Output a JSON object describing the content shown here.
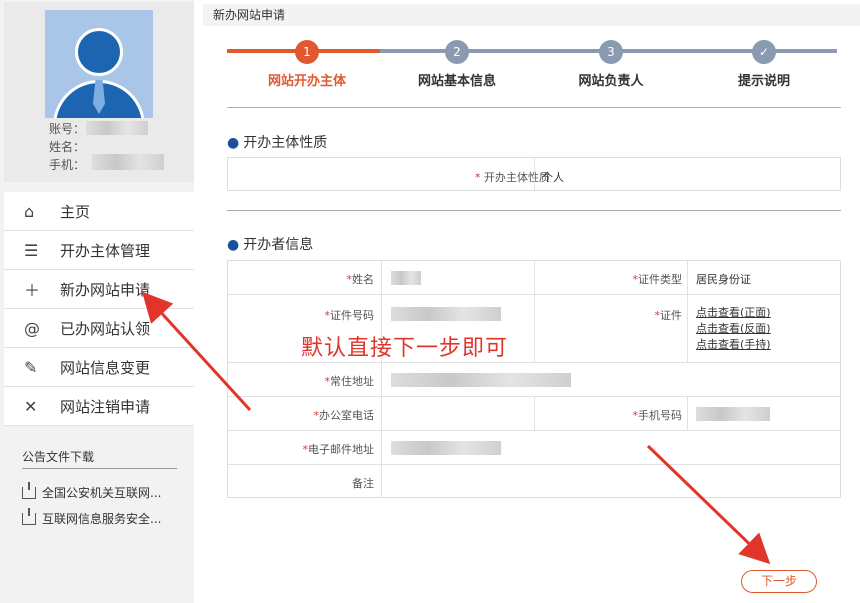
{
  "profile": {
    "account_label": "账号：",
    "name_label": "姓名：",
    "phone_label": "手机："
  },
  "menu": {
    "items": [
      {
        "icon": "home-icon",
        "glyph": "⌂",
        "label": "主页"
      },
      {
        "icon": "list-icon",
        "glyph": "☰",
        "label": "开办主体管理"
      },
      {
        "icon": "plus-icon",
        "glyph": "＋",
        "label": "新办网站申请"
      },
      {
        "icon": "at-icon",
        "glyph": "@",
        "label": "已办网站认领"
      },
      {
        "icon": "edit-icon",
        "glyph": "✎",
        "label": "网站信息变更"
      },
      {
        "icon": "close-icon",
        "glyph": "✕",
        "label": "网站注销申请"
      }
    ]
  },
  "downloads": {
    "title": "公告文件下载",
    "items": [
      "全国公安机关互联网...",
      "互联网信息服务安全..."
    ]
  },
  "page": {
    "header": "新办网站申请"
  },
  "steps": [
    {
      "number": "1",
      "label": "网站开办主体",
      "state": "active"
    },
    {
      "number": "2",
      "label": "网站基本信息",
      "state": "pending"
    },
    {
      "number": "3",
      "label": "网站负责人",
      "state": "pending"
    },
    {
      "number": "✓",
      "label": "提示说明",
      "state": "pending"
    }
  ],
  "section1": {
    "title": "开办主体性质",
    "field_label": "开办主体性质",
    "field_value": "个人"
  },
  "section2": {
    "title": "开办者信息",
    "name_label": "姓名",
    "id_type_label": "证件类型",
    "id_type_value": "居民身份证",
    "id_number_label": "证件号码",
    "cert_label": "证件",
    "cert_links": [
      "点击查看(正面)",
      "点击查看(反面)",
      "点击查看(手持)"
    ],
    "address_label": "常住地址",
    "office_phone_label": "办公室电话",
    "mobile_label": "手机号码",
    "email_label": "电子邮件地址",
    "remark_label": "备注",
    "required_mark": "*"
  },
  "annotation": {
    "text": "默认直接下一步即可"
  },
  "actions": {
    "next_label": "下一步"
  },
  "colors": {
    "accent": "#e15a2f",
    "step_pending": "#8a9ab0",
    "annotation_red": "#e1342a",
    "avatar_blue": "#1d65b1"
  }
}
